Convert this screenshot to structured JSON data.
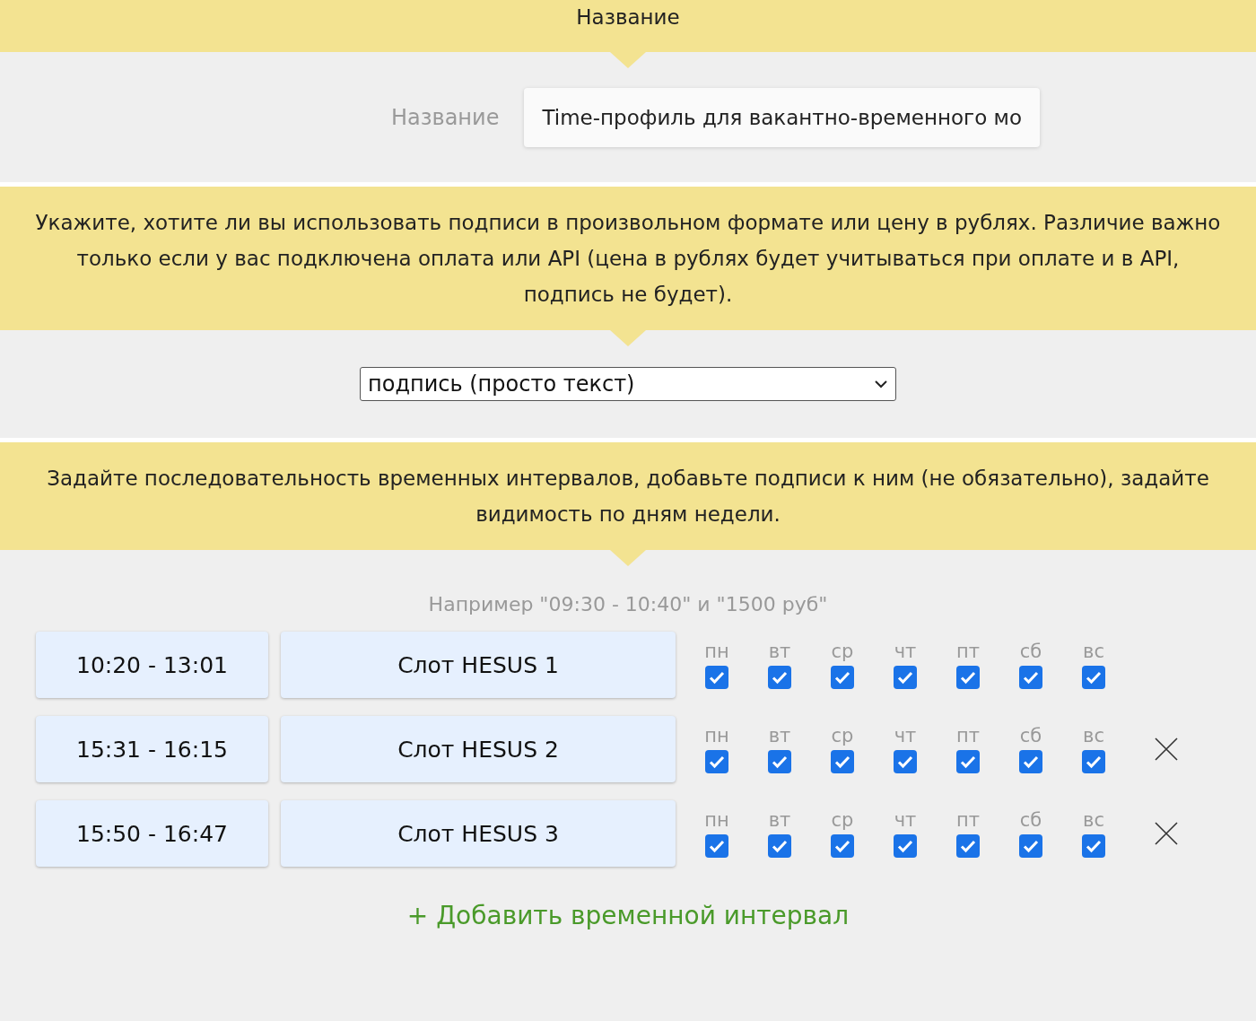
{
  "name_section": {
    "header": "Название",
    "label": "Название",
    "value": "Time-профиль для вакантно-временного мо"
  },
  "price_section": {
    "header": "Укажите, хотите ли вы использовать подписи в произвольном формате или цену в рублях. Различие важно только если у вас подключена оплата или API (цена в рублях будет учитываться при оплате и в API, подпись не будет).",
    "select_value": "подпись (просто текст)"
  },
  "intervals_section": {
    "header": "Задайте последовательность временных интервалов, добавьте подписи к ним (не обязательно), задайте видимость по дням недели.",
    "hint": "Например \"09:30 - 10:40\" и \"1500 руб\"",
    "rows": [
      {
        "time": "10:20 - 13:01",
        "caption": "Слот HESUS 1",
        "removable": false,
        "days": [
          {
            "label": "пн",
            "checked": true
          },
          {
            "label": "вт",
            "checked": true
          },
          {
            "label": "ср",
            "checked": true
          },
          {
            "label": "чт",
            "checked": true
          },
          {
            "label": "пт",
            "checked": true
          },
          {
            "label": "сб",
            "checked": true
          },
          {
            "label": "вс",
            "checked": true
          }
        ]
      },
      {
        "time": "15:31 - 16:15",
        "caption": "Слот HESUS 2",
        "removable": true,
        "days": [
          {
            "label": "пн",
            "checked": true
          },
          {
            "label": "вт",
            "checked": true
          },
          {
            "label": "ср",
            "checked": true
          },
          {
            "label": "чт",
            "checked": true
          },
          {
            "label": "пт",
            "checked": true
          },
          {
            "label": "сб",
            "checked": true
          },
          {
            "label": "вс",
            "checked": true
          }
        ]
      },
      {
        "time": "15:50 - 16:47",
        "caption": "Слот HESUS 3",
        "removable": true,
        "days": [
          {
            "label": "пн",
            "checked": true
          },
          {
            "label": "вт",
            "checked": true
          },
          {
            "label": "ср",
            "checked": true
          },
          {
            "label": "чт",
            "checked": true
          },
          {
            "label": "пт",
            "checked": true
          },
          {
            "label": "сб",
            "checked": true
          },
          {
            "label": "вс",
            "checked": true
          }
        ]
      }
    ],
    "add_link": "+ Добавить временной интервал"
  }
}
